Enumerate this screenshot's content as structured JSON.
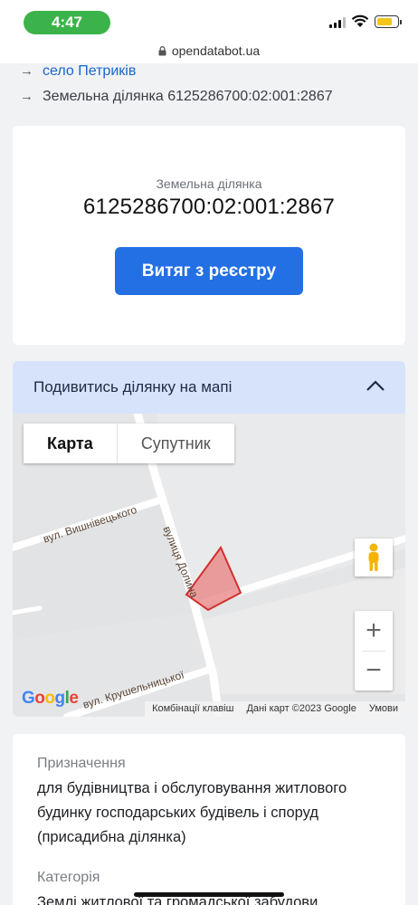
{
  "status_bar": {
    "time": "4:47"
  },
  "browser": {
    "domain": "opendatabot.ua"
  },
  "breadcrumbs": [
    {
      "label": "село Петриків",
      "is_link": true
    },
    {
      "label": "Земельна ділянка 6125286700:02:001:2867",
      "is_link": false
    }
  ],
  "parcel": {
    "label": "Земельна ділянка",
    "number": "6125286700:02:001:2867",
    "extract_button": "Витяг з реєстру"
  },
  "map_section": {
    "title": "Подивитись ділянку на мапі",
    "map_type": {
      "active": "Карта",
      "inactive": "Супутник"
    },
    "streets": {
      "vyshnivetskoho": "вул. Вишнівецького",
      "dolyna": "вулиця Долина",
      "krushelnytskoi": "вул. Крушельницької"
    },
    "zoom_in": "+",
    "zoom_out": "−",
    "google": "Google",
    "footer": {
      "shortcuts": "Комбінації клавіш",
      "map_data": "Дані карт ©2023 Google",
      "terms": "Умови"
    }
  },
  "info": {
    "purpose_label": "Призначення",
    "purpose_value": "для будівництва і обслуговування житлового будинку господарських будівель і споруд (присадибна ділянка)",
    "category_label": "Категорія",
    "category_value": "Землі житлової та громадської забудови"
  },
  "colors": {
    "accent": "#2270e4",
    "link": "#1a66c9",
    "status_green": "#3cb34a",
    "map_header_bg": "#d6e3fb",
    "parcel_fill": "#e57373"
  }
}
